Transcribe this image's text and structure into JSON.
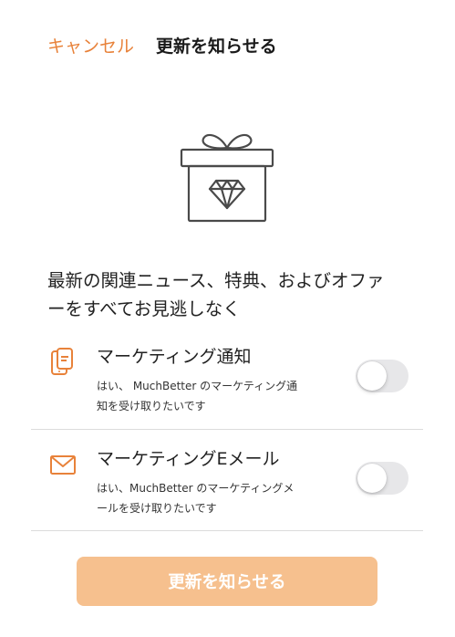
{
  "header": {
    "cancel_label": "キャンセル",
    "title": "更新を知らせる"
  },
  "hero": {
    "icon": "gift-diamond-icon"
  },
  "headline": {
    "line1": "最新の関連ニュース、特典、およびオファ",
    "line2": "ーをすべてお見逃しなく"
  },
  "options": [
    {
      "icon": "phone-notification-icon",
      "title": "マーケティング通知",
      "desc_line1": "はい、 MuchBetter のマーケティング通",
      "desc_line2": "知を受け取りたいです",
      "enabled": false
    },
    {
      "icon": "envelope-icon",
      "title": "マーケティングEメール",
      "desc_line1": "はい、MuchBetter のマーケティングメ",
      "desc_line2": "ールを受け取りたいです",
      "enabled": false
    }
  ],
  "submit": {
    "label": "更新を知らせる",
    "disabled": true
  },
  "colors": {
    "accent": "#e8823a",
    "button_disabled": "#f6c08e",
    "toggle_off": "#e7e7e9",
    "divider": "#dcdcdc"
  }
}
